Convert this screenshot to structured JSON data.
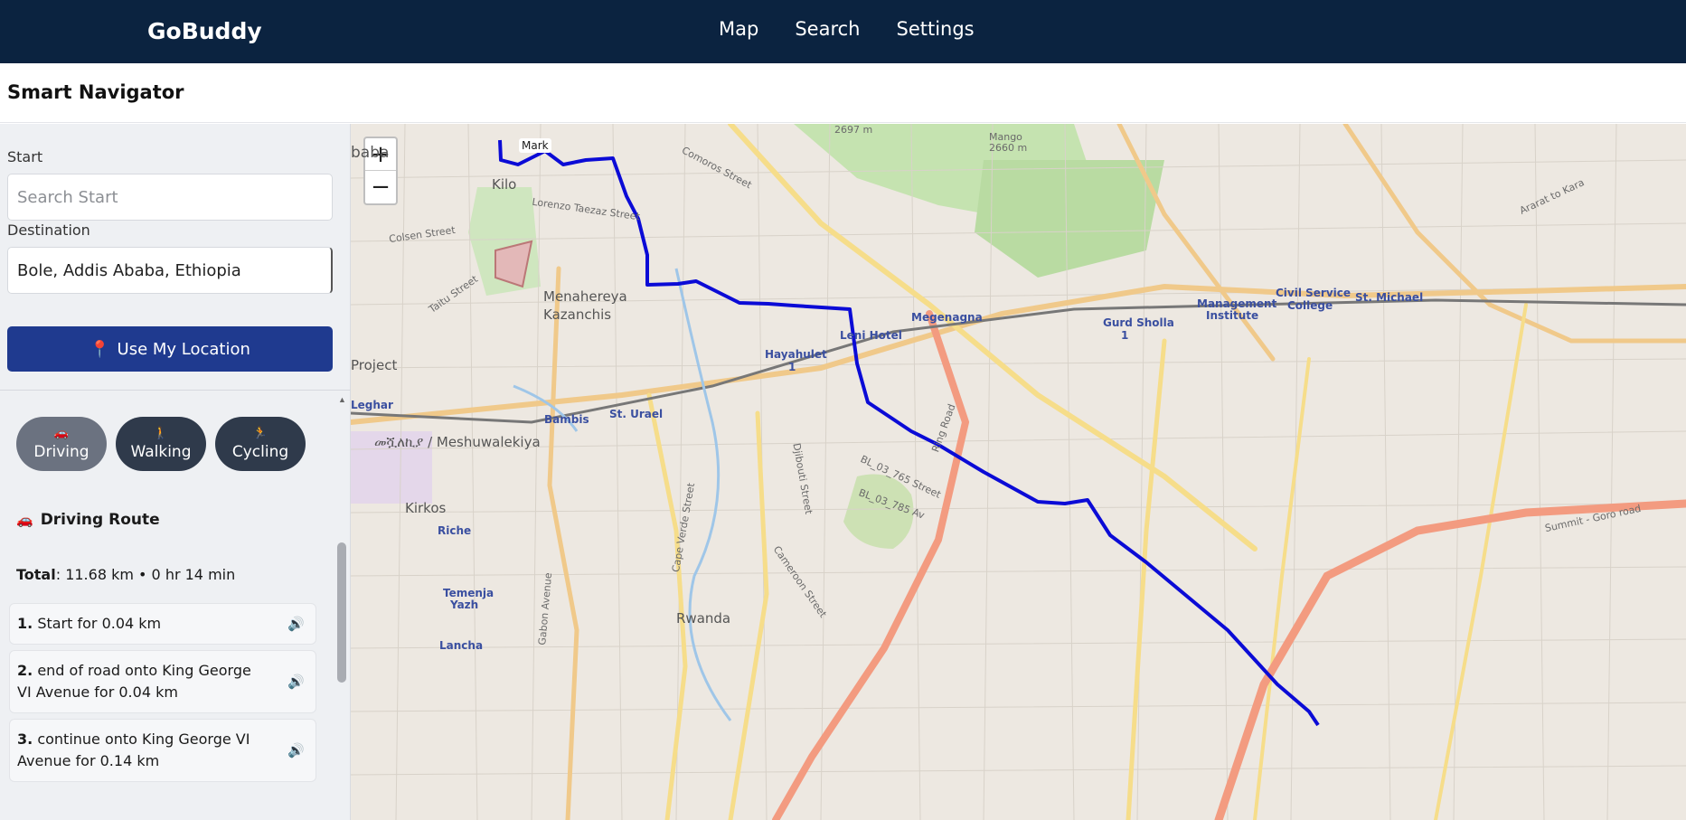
{
  "app": {
    "brand": "GoBuddy"
  },
  "nav": {
    "items": [
      "Map",
      "Search",
      "Settings"
    ]
  },
  "page": {
    "title": "Smart Navigator"
  },
  "form": {
    "start_label": "Start",
    "start_placeholder": "Search Start",
    "start_value": "",
    "destination_label": "Destination",
    "destination_value": "Bole, Addis Ababa, Ethiopia",
    "location_button": "Use My Location"
  },
  "modes": {
    "driving": "Driving",
    "walking": "Walking",
    "cycling": "Cycling",
    "active": "Driving"
  },
  "route": {
    "title": "Driving Route",
    "total_label": "Total",
    "total_value": ": 11.68 km • 0 hr 14 min",
    "steps": [
      {
        "num": "1.",
        "text": "Start for 0.04 km"
      },
      {
        "num": "2.",
        "text": "end of road onto King George VI Avenue for 0.04 km"
      },
      {
        "num": "3.",
        "text": "continue onto King George VI Avenue for 0.14 km"
      }
    ]
  },
  "map": {
    "zoom_in": "+",
    "zoom_out": "−",
    "marker_label": "Mark",
    "route_color": "#0b0bd6",
    "labels": {
      "menahereya": "Menahereya",
      "kazanchis": "Kazanchis",
      "hayahulet": "Hayahulet",
      "hayahulet_num": "1",
      "leni_hotel": "Leni Hotel",
      "megenagna": "Megenagna",
      "gurd_sholla": "Gurd Sholla",
      "gurd_sholla_num": "1",
      "management": "Management",
      "institute": "Institute",
      "civil_service": "Civil Service",
      "college": "College",
      "st_michael": "St. Michael",
      "leghar": "Leghar",
      "bambis": "Bambis",
      "st_urael": "St. Urael",
      "meshuwalekiya": "መሿለኪያ / Meshuwalekiya",
      "kirkos": "Kirkos",
      "riche": "Riche",
      "temenja": "Temenja",
      "yazh": "Yazh",
      "lancha": "Lancha",
      "rwanda": "Rwanda",
      "arat_kilo": "Kilo",
      "abeba": "baba",
      "project": "Project",
      "elev1": "2697 m",
      "mount_mango": "Mango",
      "mount_mango_elev": "2660 m",
      "colsen": "Colsen Street",
      "taitu": "Taitu Street",
      "lorenzo": "Lorenzo Taezaz Street",
      "comoros": "Comoros Street",
      "ring_road": "Ring Road",
      "cameroon": "Cameroon Street",
      "cape_verde": "Cape Verde Street",
      "gabon": "Gabon Avenue",
      "dibouti": "Djibouti Street",
      "bl_765": "BL_03_765 Street",
      "bl_785": "BL_03_785 Av",
      "summit": "Summit - Goro road",
      "ararat": "Ararat to Kara"
    }
  }
}
